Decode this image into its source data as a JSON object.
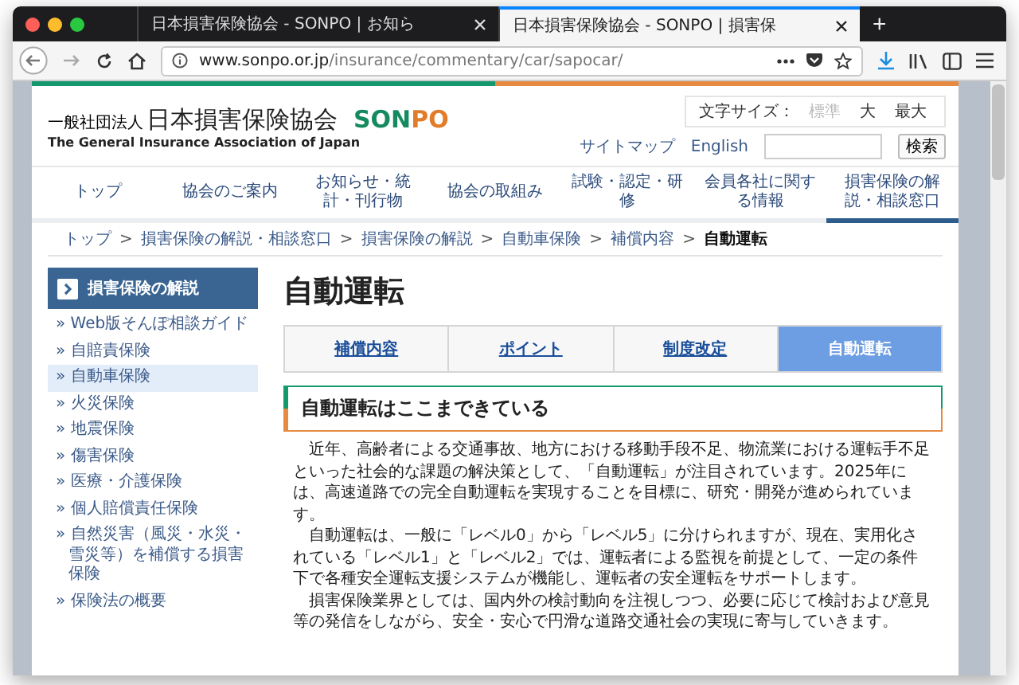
{
  "browser": {
    "tabs": [
      {
        "title": "日本損害保険協会 - SONPO | お知ら",
        "selected": false
      },
      {
        "title": "日本損害保険協会 - SONPO | 損害保",
        "selected": true
      }
    ],
    "new_tab": "+",
    "url": {
      "host": "www.sonpo.or.jp",
      "path": "/insurance/commentary/car/sapocar/"
    }
  },
  "header": {
    "org_type": "一般社団法人",
    "org_name": "日本損害保険協会",
    "brand": "SONPO",
    "org_name_en": "The General Insurance Association of Japan",
    "font_size": {
      "label": "文字サイズ：",
      "options": [
        {
          "label": "標準",
          "selected": true
        },
        {
          "label": "大",
          "selected": false
        },
        {
          "label": "最大",
          "selected": false
        }
      ]
    },
    "links": [
      "サイトマップ",
      "English"
    ],
    "search_button": "検索"
  },
  "nav": [
    {
      "label": "トップ",
      "selected": false
    },
    {
      "label": "協会のご案内",
      "selected": false
    },
    {
      "label": "お知らせ・統計・刊行物",
      "selected": false
    },
    {
      "label": "協会の取組み",
      "selected": false
    },
    {
      "label": "試験・認定・研修",
      "selected": false
    },
    {
      "label": "会員各社に関する情報",
      "selected": false
    },
    {
      "label": "損害保険の解説・相談窓口",
      "selected": true
    }
  ],
  "breadcrumb": {
    "separator": ">",
    "items": [
      "トップ",
      "損害保険の解説・相談窓口",
      "損害保険の解説",
      "自動車保険",
      "補償内容",
      "自動運転"
    ]
  },
  "sidebar": {
    "title": "損害保険の解説",
    "items": [
      {
        "label": "» Web版そんぽ相談ガイド",
        "selected": false
      },
      {
        "label": "» 自賠責保険",
        "selected": false
      },
      {
        "label": "» 自動車保険",
        "selected": true
      },
      {
        "label": "» 火災保険",
        "selected": false
      },
      {
        "label": "» 地震保険",
        "selected": false
      },
      {
        "label": "» 傷害保険",
        "selected": false
      },
      {
        "label": "» 医療・介護保険",
        "selected": false
      },
      {
        "label": "» 個人賠償責任保険",
        "selected": false
      },
      {
        "label": "» 自然災害（風災・水災・雪災等）を補償する損害保険",
        "selected": false
      },
      {
        "label": "» 保険法の概要",
        "selected": false
      }
    ]
  },
  "main": {
    "title": "自動運転",
    "tabs": [
      {
        "label": "補償内容",
        "selected": false
      },
      {
        "label": "ポイント",
        "selected": false
      },
      {
        "label": "制度改定",
        "selected": false
      },
      {
        "label": "自動運転",
        "selected": true
      }
    ],
    "section_heading": "自動運転はここまできている",
    "paragraphs": [
      "近年、高齢者による交通事故、地方における移動手段不足、物流業における運転手不足といった社会的な課題の解決策として、「自動運転」が注目されています。2025年には、高速道路での完全自動運転を実現することを目標に、研究・開発が進められています。",
      "自動運転は、一般に「レベル0」から「レベル5」に分けられますが、現在、実用化されている「レベル1」と「レベル2」では、運転者による監視を前提として、一定の条件下で各種安全運転支援システムが機能し、運転者の安全運転をサポートします。",
      "損害保険業界としては、国内外の検討動向を注視しつつ、必要に応じて検討および意見等の発信をしながら、安全・安心で円滑な道路交通社会の実現に寄与していきます。"
    ]
  }
}
